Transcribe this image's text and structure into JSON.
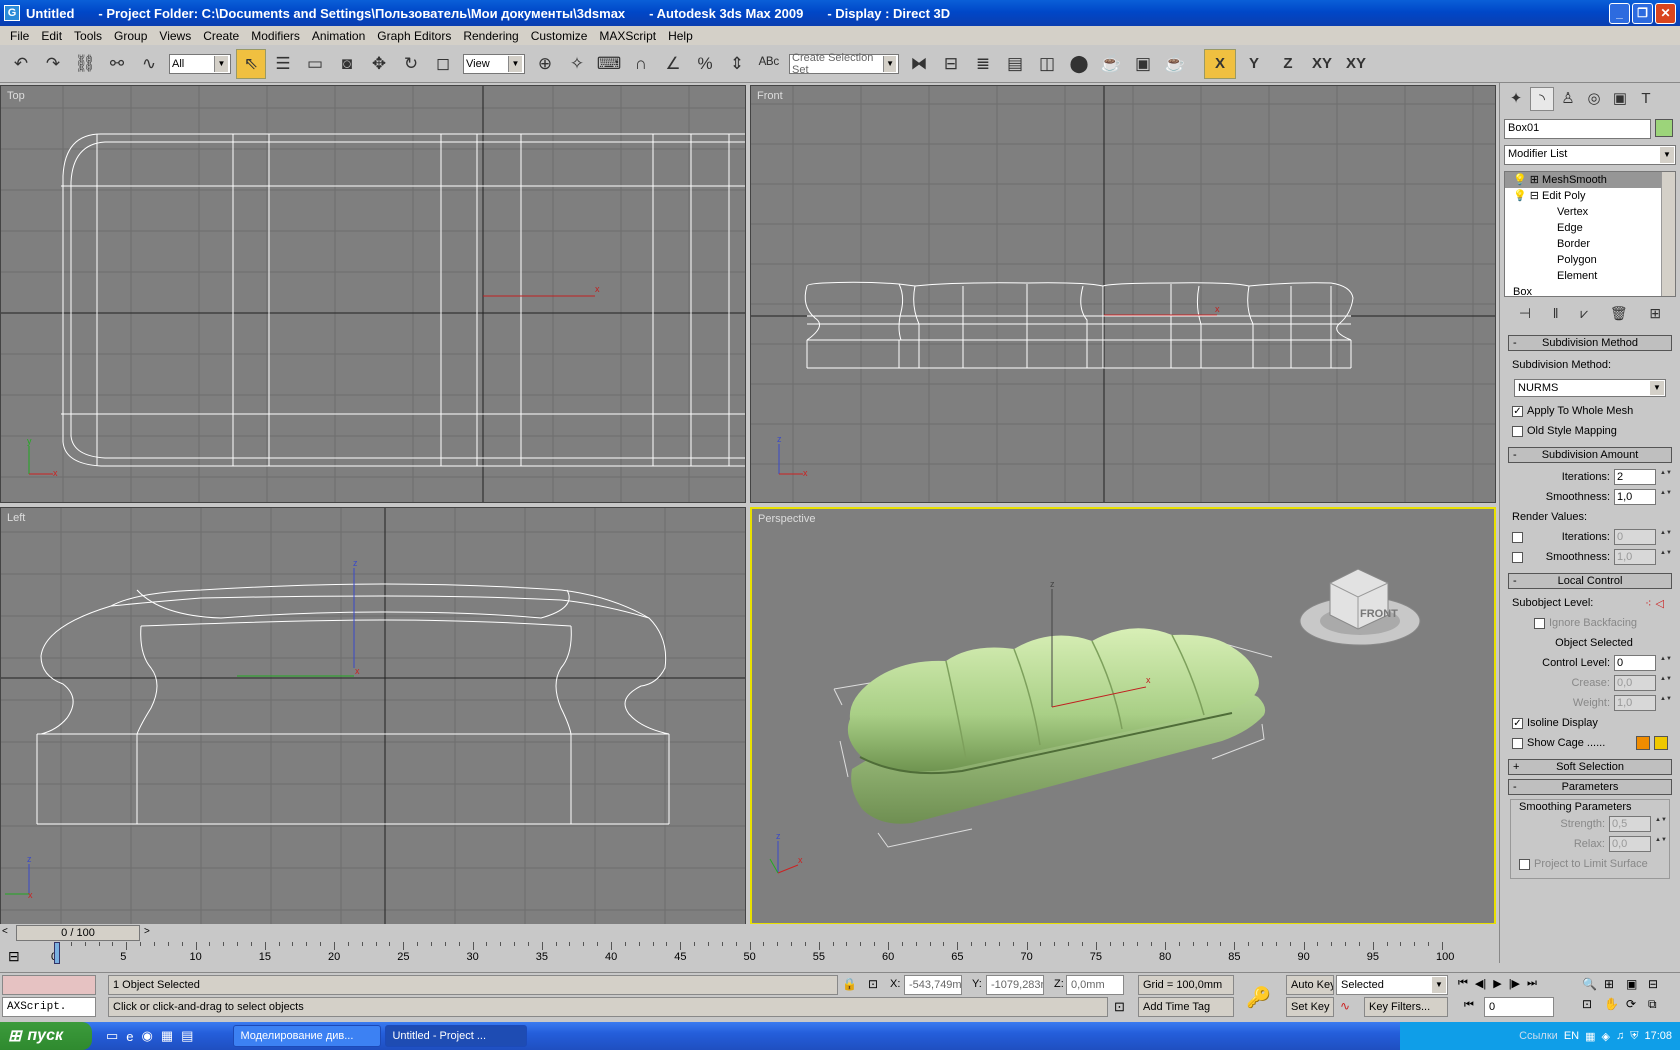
{
  "titlebar": {
    "title": "Untitled",
    "project": "- Project Folder: C:\\Documents and Settings\\Пользователь\\Мои документы\\3dsmax",
    "app": "- Autodesk 3ds Max  2009",
    "display": "- Display : Direct 3D"
  },
  "menu": [
    "File",
    "Edit",
    "Tools",
    "Group",
    "Views",
    "Create",
    "Modifiers",
    "Animation",
    "Graph Editors",
    "Rendering",
    "Customize",
    "MAXScript",
    "Help"
  ],
  "toolbar": {
    "filter": "All",
    "coord": "View",
    "selection_set": "Create Selection Set",
    "axes": [
      "X",
      "Y",
      "Z",
      "XY",
      "XY"
    ]
  },
  "viewports": {
    "top": "Top",
    "front": "Front",
    "left": "Left",
    "perspective": "Perspective",
    "viewcube": "FRONT"
  },
  "panel": {
    "object_name": "Box01",
    "modifier_list": "Modifier List",
    "stack": [
      "MeshSmooth",
      "Edit Poly",
      "Vertex",
      "Edge",
      "Border",
      "Polygon",
      "Element",
      "Box"
    ],
    "subdivision_method": {
      "header": "Subdivision Method",
      "label": "Subdivision Method:",
      "value": "NURMS",
      "apply": "Apply To Whole Mesh",
      "old": "Old Style Mapping"
    },
    "subdivision_amount": {
      "header": "Subdivision Amount",
      "iterations_label": "Iterations:",
      "iterations": "2",
      "smoothness_label": "Smoothness:",
      "smoothness": "1,0",
      "render_values": "Render Values:",
      "r_iterations": "0",
      "r_smoothness": "1,0"
    },
    "local_control": {
      "header": "Local Control",
      "subobject": "Subobject Level:",
      "ignore": "Ignore Backfacing",
      "selected": "Object Selected",
      "control_level_label": "Control Level:",
      "control_level": "0",
      "crease_label": "Crease:",
      "crease": "0,0",
      "weight_label": "Weight:",
      "weight": "1,0",
      "isoline": "Isoline Display",
      "cage": "Show Cage ......"
    },
    "soft_selection": "Soft Selection",
    "parameters": {
      "header": "Parameters",
      "group": "Smoothing Parameters",
      "strength_label": "Strength:",
      "strength": "0,5",
      "relax_label": "Relax:",
      "relax": "0,0",
      "project": "Project to Limit Surface"
    }
  },
  "timeline": {
    "slider": "0 / 100",
    "ticks": [
      "0",
      "5",
      "10",
      "15",
      "20",
      "25",
      "30",
      "35",
      "40",
      "45",
      "50",
      "55",
      "60",
      "65",
      "70",
      "75",
      "80",
      "85",
      "90",
      "95",
      "100"
    ]
  },
  "status": {
    "maxscript": "AXScript.",
    "selected": "1 Object Selected",
    "prompt": "Click or click-and-drag to select objects",
    "x_label": "X:",
    "x": "-543,749mi",
    "y_label": "Y:",
    "y": "-1079,283r",
    "z_label": "Z:",
    "z": "0,0mm",
    "grid": "Grid = 100,0mm",
    "autokey": "Auto Key",
    "selected_dd": "Selected",
    "setkey": "Set Key",
    "keyfilters": "Key Filters...",
    "addtimetag": "Add Time Tag",
    "frame": "0"
  },
  "taskbar": {
    "start": "пуск",
    "tasks": [
      "Моделирование див...",
      "Untitled      - Project ..."
    ],
    "links": "Ссылки",
    "lang": "EN",
    "time": "17:08"
  }
}
